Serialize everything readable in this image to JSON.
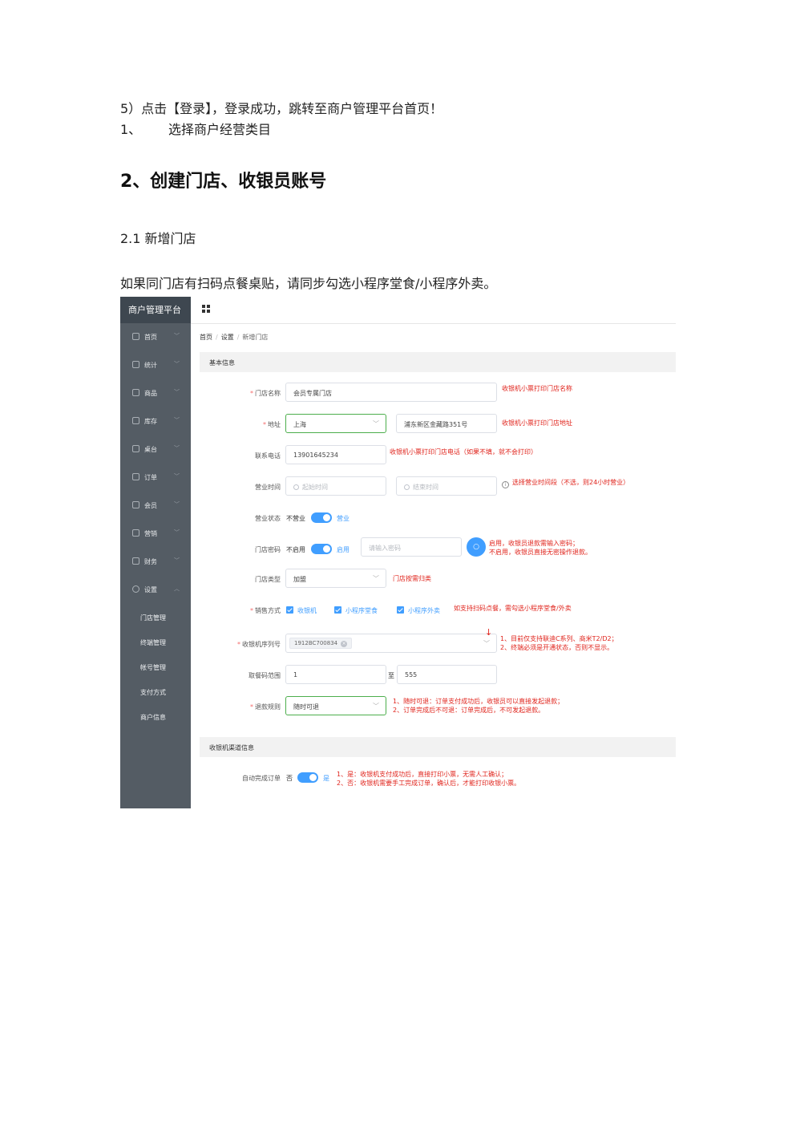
{
  "doc": {
    "line1": "5）点击【登录】，登录成功，跳转至商户管理平台首页！",
    "line2_num": "1、",
    "line2_text": "选择商户经营类目",
    "heading2": "2、创建门店、收银员账号",
    "heading3": "2.1 新增门店",
    "para1": "如果同门店有扫码点餐桌贴，请同步勾选小程序堂食/小程序外卖。"
  },
  "app": {
    "brand": "商户管理平台",
    "menu": [
      {
        "label": "首页"
      },
      {
        "label": "统计"
      },
      {
        "label": "商品"
      },
      {
        "label": "库存"
      },
      {
        "label": "桌台"
      },
      {
        "label": "订单"
      },
      {
        "label": "会员"
      },
      {
        "label": "营销"
      },
      {
        "label": "财务"
      },
      {
        "label": "设置"
      }
    ],
    "submenu": [
      {
        "label": "门店管理"
      },
      {
        "label": "终端管理"
      },
      {
        "label": "帐号管理"
      },
      {
        "label": "支付方式"
      },
      {
        "label": "商户信息"
      }
    ],
    "breadcrumb": {
      "home": "首页",
      "settings": "设置",
      "current": "新增门店",
      "sep": "/"
    },
    "section1": "基本信息",
    "section2": "收银机渠道信息",
    "form": {
      "store_name_label": "门店名称",
      "store_name_value": "会员专属门店",
      "store_name_note": "收银机小票打印门店名称",
      "address_label": "地址",
      "city_value": "上海",
      "street_value": "浦东新区金藏路351号",
      "address_note": "收银机小票打印门店地址",
      "phone_label": "联系电话",
      "phone_value": "13901645234",
      "phone_note": "收银机小票打印门店电话（如果不填，就不会打印）",
      "hours_label": "营业时间",
      "hours_start_placeholder": "起始时间",
      "hours_end_placeholder": "结束时间",
      "hours_note": "选择营业时间段（不选，则24小时营业）",
      "status_label": "营业状态",
      "status_off": "不营业",
      "status_on": "营业",
      "pwd_label": "门店密码",
      "pwd_off": "不启用",
      "pwd_on": "启用",
      "pwd_placeholder": "请输入密码",
      "pwd_note_1": "启用，收银员退款需输入密码；",
      "pwd_note_2": "不启用，收银员直接无密操作退款。",
      "type_label": "门店类型",
      "type_value": "加盟",
      "type_note": "门店按需归类",
      "sales_label": "销售方式",
      "sales_opt1": "收银机",
      "sales_opt2": "小程序堂食",
      "sales_opt3": "小程序外卖",
      "sales_note": "如支持扫码点餐，需勾选小程序堂食/外卖",
      "serial_label": "收银机序列号",
      "serial_tag": "1912BC700834",
      "serial_note_1": "1、目前仅支持联迪C系列、商米T2/D2；",
      "serial_note_2": "2、终端必须是开通状态，否则不显示。",
      "pickup_label": "取餐码范围",
      "pickup_from": "1",
      "pickup_to_label": "至",
      "pickup_to": "555",
      "refund_label": "退款规则",
      "refund_value": "随时可退",
      "refund_note_1": "1、随时可退：订单支付成功后，收银员可以直接发起退款；",
      "refund_note_2": "2、订单完成后不可退：订单完成后，不可发起退款。",
      "auto_label": "自动完成订单",
      "auto_off": "否",
      "auto_on": "是",
      "auto_note_1": "1、是：收银机支付成功后，直接打印小票，无需人工确认；",
      "auto_note_2": "2、否：收银机需要手工完成订单，确认后，才能打印收银小票。"
    }
  }
}
